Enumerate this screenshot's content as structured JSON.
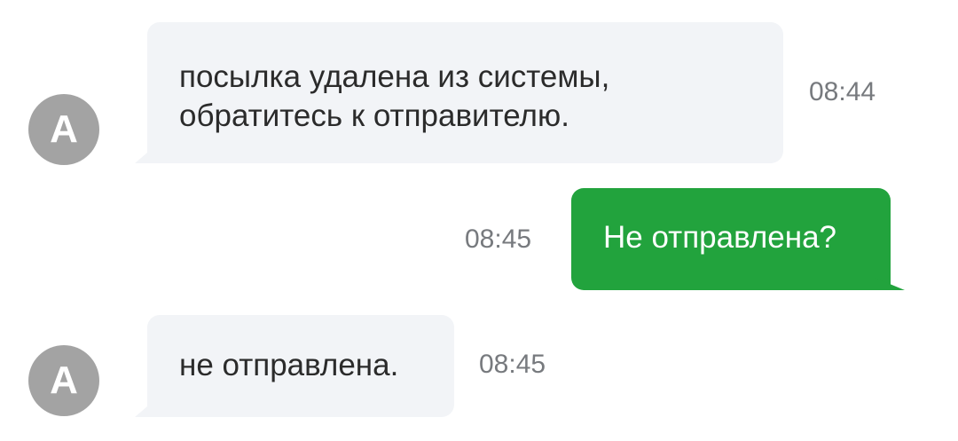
{
  "messages": [
    {
      "direction": "incoming",
      "avatar_letter": "A",
      "text": "посылка удалена из системы,\nобратитесь к отправителю.",
      "time": "08:44"
    },
    {
      "direction": "outgoing",
      "text": "Не отправлена?",
      "time": "08:45"
    },
    {
      "direction": "incoming",
      "avatar_letter": "A",
      "text": "не отправлена.",
      "time": "08:45"
    }
  ],
  "colors": {
    "incoming_bubble": "#f2f4f7",
    "outgoing_bubble": "#22a33d",
    "avatar": "#a3a3a3",
    "time_text": "#777a7e"
  }
}
